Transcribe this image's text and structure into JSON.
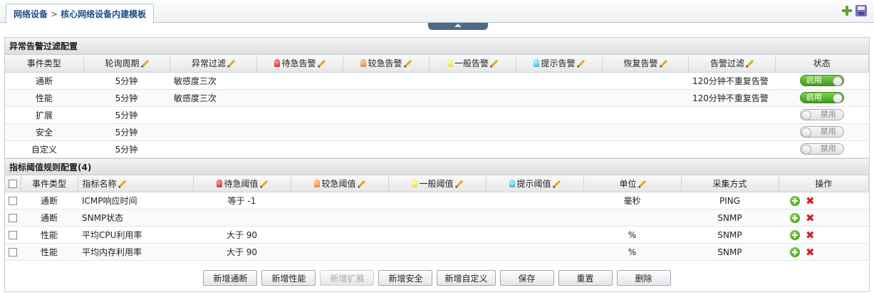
{
  "breadcrumb": {
    "root": "网络设备",
    "sep": ">",
    "current": "核心网络设备内建模板"
  },
  "filter_section": {
    "title": "异常告警过滤配置",
    "headers": [
      "事件类型",
      "轮询周期",
      "异常过滤",
      "待急告警",
      "较急告警",
      "一般告警",
      "提示告警",
      "恢复告警",
      "告警过滤",
      "状态"
    ],
    "rows": [
      {
        "type": "通断",
        "period": "5分钟",
        "abnormal": "敏感度三次",
        "alarm_filter": "120分钟不重复告警",
        "status": "启用",
        "enabled": true
      },
      {
        "type": "性能",
        "period": "5分钟",
        "abnormal": "敏感度三次",
        "alarm_filter": "120分钟不重复告警",
        "status": "启用",
        "enabled": true
      },
      {
        "type": "扩展",
        "period": "5分钟",
        "abnormal": "",
        "alarm_filter": "",
        "status": "禁用",
        "enabled": false
      },
      {
        "type": "安全",
        "period": "5分钟",
        "abnormal": "",
        "alarm_filter": "",
        "status": "禁用",
        "enabled": false
      },
      {
        "type": "自定义",
        "period": "5分钟",
        "abnormal": "",
        "alarm_filter": "",
        "status": "禁用",
        "enabled": false
      }
    ]
  },
  "threshold_section": {
    "title": "指标阈值规则配置(4)",
    "headers": [
      "事件类型",
      "指标名称",
      "待急阈值",
      "较急阈值",
      "一般阈值",
      "提示阈值",
      "单位",
      "采集方式",
      "操作"
    ],
    "rows": [
      {
        "type": "通断",
        "metric": "ICMP响应时间",
        "urgent": "等于 -1",
        "unit": "毫秒",
        "method": "PING"
      },
      {
        "type": "通断",
        "metric": "SNMP状态",
        "urgent": "",
        "unit": "",
        "method": "SNMP"
      },
      {
        "type": "性能",
        "metric": "平均CPU利用率",
        "urgent": "大于 90",
        "unit": "%",
        "method": "SNMP"
      },
      {
        "type": "性能",
        "metric": "平均内存利用率",
        "urgent": "大于 90",
        "unit": "%",
        "method": "SNMP"
      }
    ]
  },
  "buttons": {
    "add_connect": "新增通断",
    "add_perf": "新增性能",
    "add_ext": "新增扩展",
    "add_sec": "新增安全",
    "add_custom": "新增自定义",
    "save": "保存",
    "reset": "重置",
    "delete": "删除"
  },
  "colors": {
    "enabled": "#4aa321",
    "title_blue": "#1f4e8c",
    "delete_red": "#d32020"
  }
}
